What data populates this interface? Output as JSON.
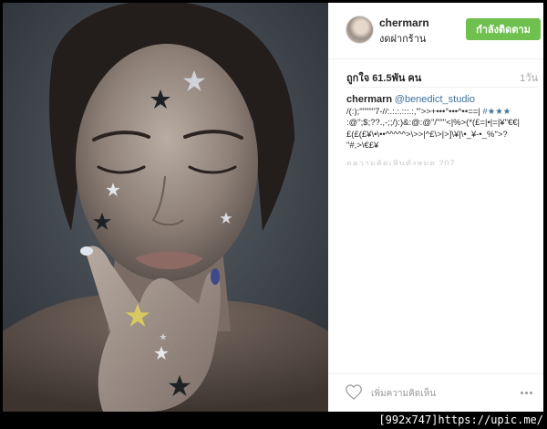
{
  "post": {
    "photo_alt": "portrait photo",
    "header": {
      "username": "chermarn",
      "location": "งดฝากร้าน",
      "follow_button": "กำลังติดตาม"
    },
    "likes": "ถูกใจ 61.5พัน คน",
    "time_ago": "1วัน",
    "caption": {
      "username": "chermarn",
      "mention": "@benedict_studio",
      "line1_text": "/(:);\"\"\"\"\"7-//:.:.:.:::.:,\"'>>+•••°•••^••==|",
      "line1_hash": " #",
      "line1_stars": "★★★",
      "line2": ":@\";$;??.,-;;/):)&:@:@\"/\"\"\"<|%>(*(£=|•|=|¥\"€€|",
      "line3": "£(£(£¥\\•\\••^^^^^>\\>>|^£\\>|>]\\¥|\\•_¥-•_%\">?",
      "line4": "\"#,>\\€£¥",
      "faded": "ดูความคิดเห็นทั้งหมด 207 รายการ"
    },
    "footer": {
      "comment_placeholder": "เพิ่มความคิดเห็น",
      "heart_icon": "heart-icon",
      "more_icon": "more-options-icon"
    }
  },
  "watermark": {
    "text": "[992x747]https://upic.me/"
  },
  "colors": {
    "follow_button": "#70c050",
    "mention": "#3f729b",
    "background": "#000000"
  }
}
